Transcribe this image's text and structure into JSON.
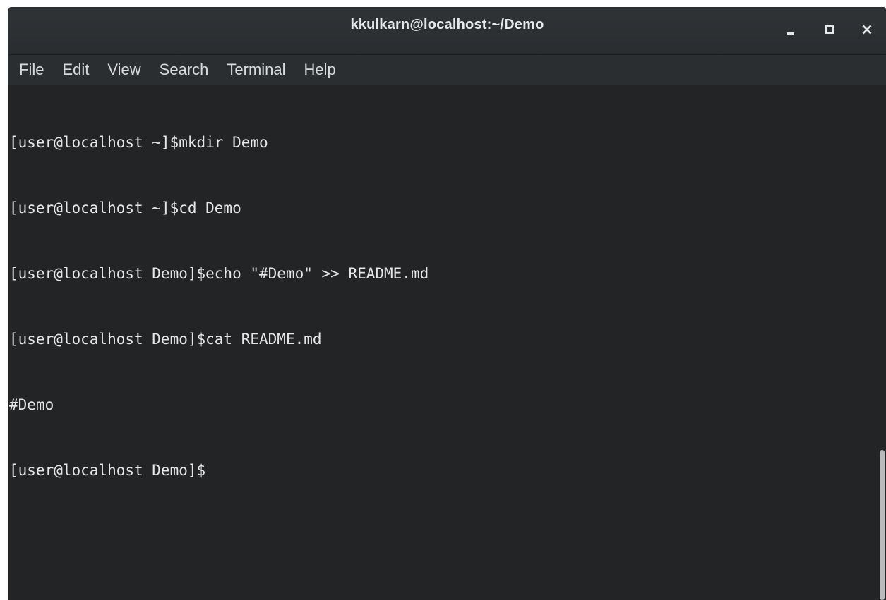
{
  "window": {
    "title": "kkulkarn@localhost:~/Demo",
    "controls": {
      "minimize": "minimize-icon",
      "maximize": "maximize-icon",
      "close": "close-icon",
      "close_glyph": "×"
    }
  },
  "menu": {
    "items": [
      "File",
      "Edit",
      "View",
      "Search",
      "Terminal",
      "Help"
    ]
  },
  "terminal": {
    "lines": [
      "[user@localhost ~]$mkdir Demo",
      "[user@localhost ~]$cd Demo",
      "[user@localhost Demo]$echo \"#Demo\" >> README.md",
      "[user@localhost Demo]$cat README.md",
      "#Demo",
      "[user@localhost Demo]$"
    ]
  },
  "colors": {
    "background": "#222425",
    "titlebar": "#2f3336",
    "menubar": "#2b2e31",
    "text": "#e6e6e6"
  }
}
